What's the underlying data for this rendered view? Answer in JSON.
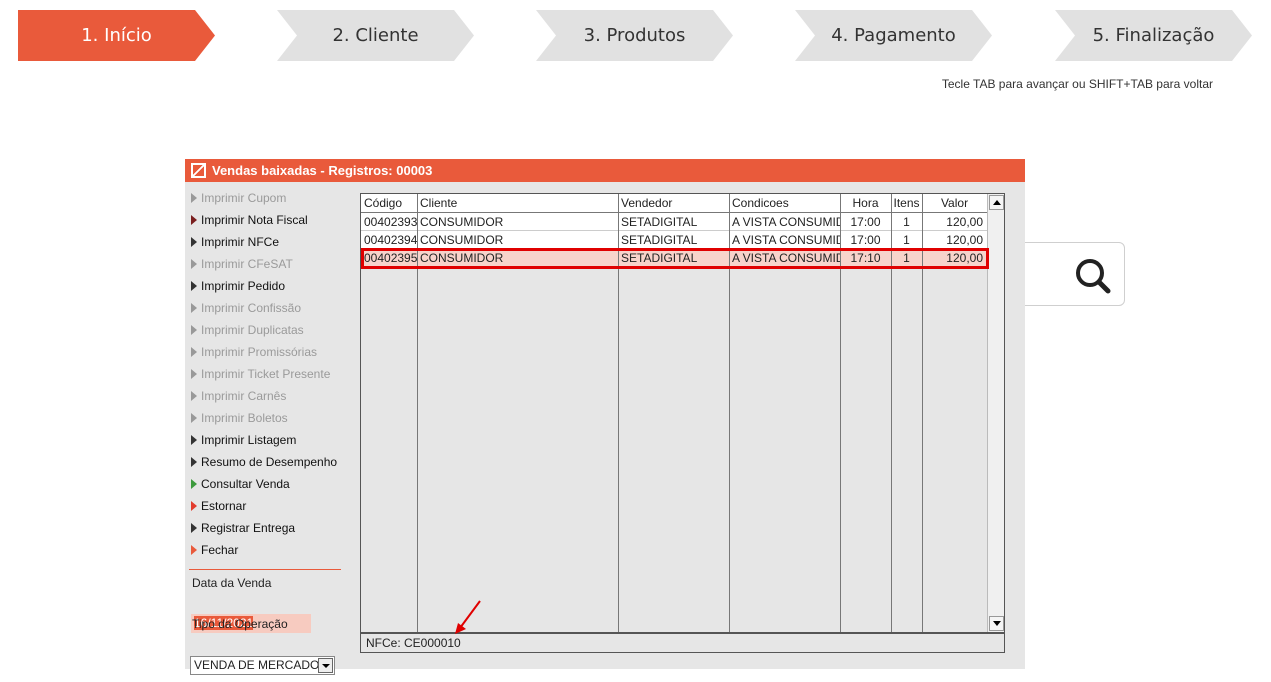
{
  "stepper": {
    "steps": [
      {
        "label": "1. Início",
        "active": true
      },
      {
        "label": "2. Cliente",
        "active": false
      },
      {
        "label": "3. Produtos",
        "active": false
      },
      {
        "label": "4. Pagamento",
        "active": false
      },
      {
        "label": "5. Finalização",
        "active": false
      }
    ],
    "hint": "Tecle TAB para avançar ou SHIFT+TAB para voltar",
    "active_color": "#e95a3b",
    "inactive_color": "#e1e1e1"
  },
  "search": {
    "icon": "search-icon"
  },
  "window": {
    "title": "Vendas baixadas - Registros: 00003",
    "menu": [
      {
        "label": "Imprimir Cupom",
        "state": "disabled"
      },
      {
        "label": "Imprimir Nota Fiscal",
        "state": "enabled"
      },
      {
        "label": "Imprimir NFCe",
        "state": "enabled"
      },
      {
        "label": "Imprimir CFeSAT",
        "state": "disabled"
      },
      {
        "label": "Imprimir Pedido",
        "state": "enabled"
      },
      {
        "label": "Imprimir Confissão",
        "state": "disabled"
      },
      {
        "label": "Imprimir Duplicatas",
        "state": "disabled"
      },
      {
        "label": "Imprimir Promissórias",
        "state": "disabled"
      },
      {
        "label": "Imprimir Ticket Presente",
        "state": "disabled"
      },
      {
        "label": "Imprimir Carnês",
        "state": "disabled"
      },
      {
        "label": "Imprimir Boletos",
        "state": "disabled"
      },
      {
        "label": "Imprimir Listagem",
        "state": "enabled"
      },
      {
        "label": "Resumo de Desempenho",
        "state": "enabled"
      },
      {
        "label": "Consultar Venda",
        "state": "enabled"
      },
      {
        "label": "Estornar",
        "state": "enabled"
      },
      {
        "label": "Registrar Entrega",
        "state": "enabled"
      },
      {
        "label": "Fechar",
        "state": "enabled"
      }
    ],
    "date_label": "Data da Venda",
    "date_value": "16/11/2021",
    "operation_label": "Tipo da Operação",
    "operation_value": "VENDA DE MERCADOR",
    "grid": {
      "columns": [
        "Código",
        "Cliente",
        "Vendedor",
        "Condicoes",
        "Hora",
        "Itens",
        "Valor"
      ],
      "rows": [
        [
          "00402393",
          "CONSUMIDOR",
          "SETADIGITAL",
          "A VISTA CONSUMID",
          "17:00",
          "1",
          "120,00"
        ],
        [
          "00402394",
          "CONSUMIDOR",
          "SETADIGITAL",
          "A VISTA CONSUMID",
          "17:00",
          "1",
          "120,00"
        ],
        [
          "00402395",
          "CONSUMIDOR",
          "SETADIGITAL",
          "A VISTA CONSUMID",
          "17:10",
          "1",
          "120,00"
        ]
      ],
      "selected_row": 2
    },
    "status": "NFCe: CE000010"
  }
}
